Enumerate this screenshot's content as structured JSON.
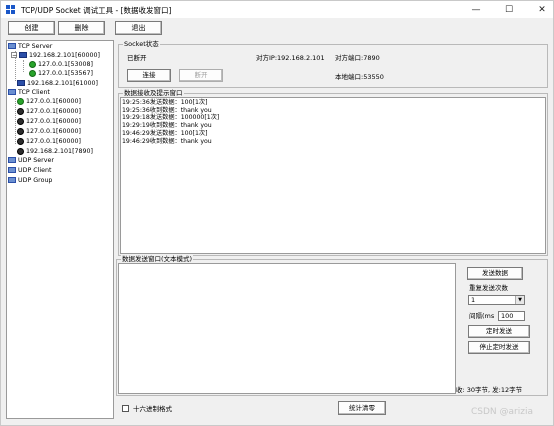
{
  "window": {
    "title": "TCP/UDP Socket 调试工具 - [数据收发窗口]",
    "controls": {
      "minimize": "—",
      "maximize": "☐",
      "close": "✕"
    }
  },
  "toolbar": {
    "create_label": "创建",
    "delete_label": "删除",
    "exit_label": "退出"
  },
  "tree": {
    "tcp_server": "TCP Server",
    "server_node": "192.168.2.101[60000]",
    "server_clients": [
      "127.0.0.1[53008]",
      "127.0.0.1[53567]"
    ],
    "server_node2": "192.168.2.101[61000]",
    "tcp_client": "TCP Client",
    "client_nodes": [
      "127.0.0.1[60000]",
      "127.0.0.1[60000]",
      "127.0.0.1[60000]",
      "127.0.0.1[60000]",
      "127.0.0.1[60000]"
    ],
    "client_node_last": "192.168.2.101[7890]",
    "udp_server": "UDP Server",
    "udp_client": "UDP Client",
    "udp_group": "UDP Group"
  },
  "socket_state": {
    "group_label": "Socket状态",
    "status": "已断开",
    "peer_ip": "对方IP:192.168.2.101",
    "peer_port": "对方端口:7890",
    "local_port": "本地端口:53550",
    "connect_label": "连接",
    "disconnect_label": "断开"
  },
  "receive": {
    "group_label": "数据接收及提示窗口",
    "lines": [
      "19:25:36发送数据：100[1次]",
      "19:25:36收到数据：thank you",
      "19:29:18发送数据：100000[1次]",
      "19:29:19收到数据：thank you",
      "19:46:29发送数据：100[1次]",
      "19:46:29收到数据：thank you"
    ]
  },
  "send": {
    "group_label": "数据发送窗口(文本模式)",
    "text": "",
    "send_button": "发送数据",
    "repeat_label": "重复发送次数",
    "repeat_value": "1",
    "interval_label": "间隔(ms",
    "interval_value": "100",
    "timer_send_button": "定时发送",
    "stop_timer_button": "停止定时发送",
    "stats": "收: 30字节, 发:12字节"
  },
  "bottom": {
    "hex_label": "十六进制格式",
    "hex_checked": false,
    "stats_clear_button": "统计清零"
  },
  "watermark": "CSDN @arizia",
  "colors": {
    "accent_blue": "#1a57c8",
    "connected_green": "#28a32a",
    "disconnected_black": "#2e2e2e"
  }
}
